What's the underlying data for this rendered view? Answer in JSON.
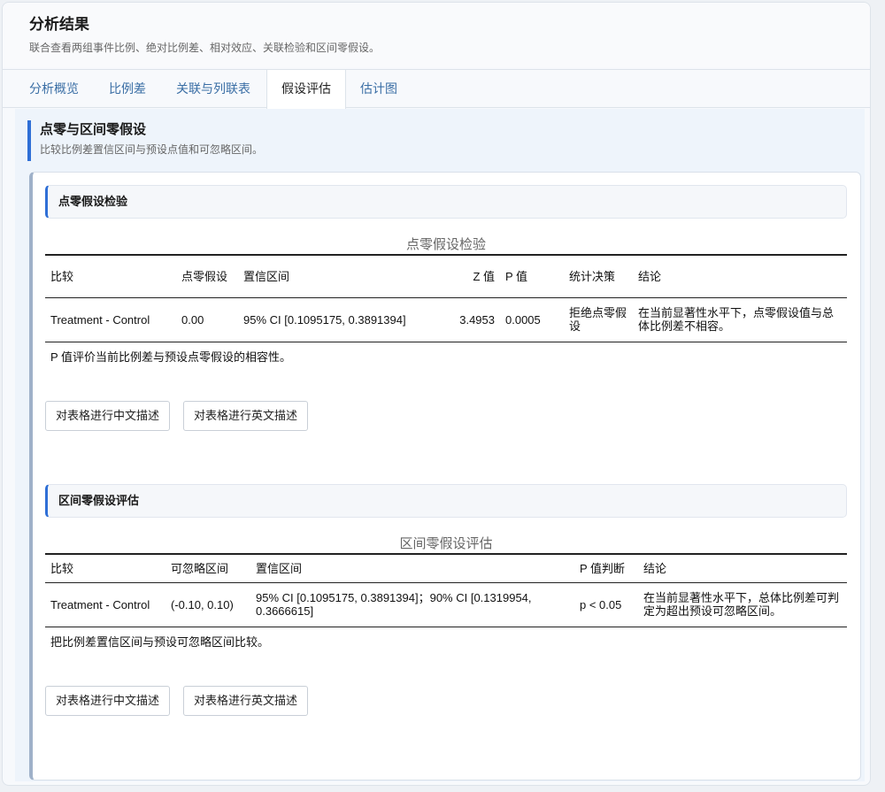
{
  "header": {
    "title": "分析结果",
    "subtitle": "联合查看两组事件比例、绝对比例差、相对效应、关联检验和区间零假设。"
  },
  "tabs": [
    "分析概览",
    "比例差",
    "关联与列联表",
    "假设评估",
    "估计图"
  ],
  "active_tab": "假设评估",
  "section": {
    "title": "点零与区间零假设",
    "subtitle": "比较比例差置信区间与预设点值和可忽略区间。"
  },
  "point_test": {
    "heading": "点零假设检验",
    "table_title": "点零假设检验",
    "columns": [
      "比较",
      "点零假设",
      "置信区间",
      "Z 值",
      "P 值",
      "统计决策",
      "结论"
    ],
    "rows": [
      [
        "Treatment - Control",
        "0.00",
        "95% CI [0.1095175, 0.3891394]",
        "3.4953",
        "0.0005",
        "拒绝点零假设",
        "在当前显著性水平下，点零假设值与总体比例差不相容。"
      ]
    ],
    "note": "P 值评价当前比例差与预设点零假设的相容性。",
    "btn_cn": "对表格进行中文描述",
    "btn_en": "对表格进行英文描述"
  },
  "interval_test": {
    "heading": "区间零假设评估",
    "table_title": "区间零假设评估",
    "columns": [
      "比较",
      "可忽略区间",
      "置信区间",
      "P 值判断",
      "结论"
    ],
    "rows": [
      [
        "Treatment - Control",
        "(-0.10, 0.10)",
        "95% CI [0.1095175, 0.3891394]；90% CI [0.1319954, 0.3666615]",
        "p < 0.05",
        "在当前显著性水平下，总体比例差可判定为超出预设可忽略区间。"
      ]
    ],
    "note": "把比例差置信区间与预设可忽略区间比较。",
    "btn_cn": "对表格进行中文描述",
    "btn_en": "对表格进行英文描述"
  }
}
